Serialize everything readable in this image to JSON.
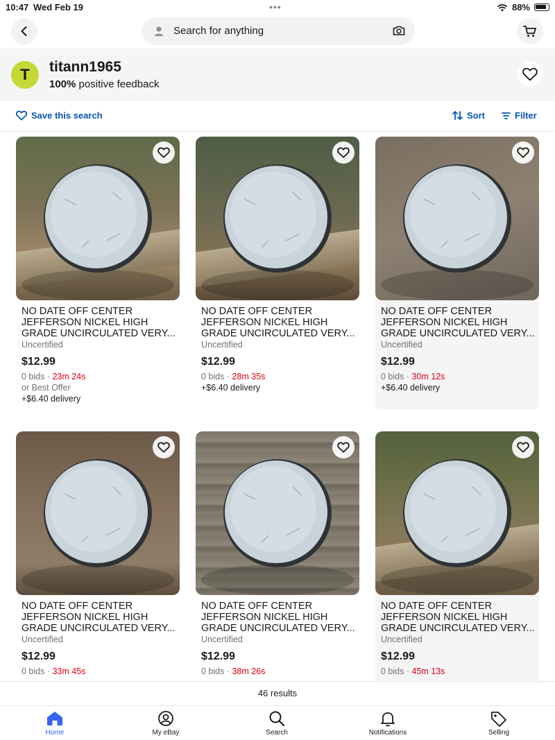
{
  "status_bar": {
    "time": "10:47",
    "date": "Wed Feb 19",
    "battery": "88%"
  },
  "search": {
    "placeholder": "Search for anything"
  },
  "seller": {
    "avatar_letter": "T",
    "name": "titann1965",
    "feedback_pct": "100%",
    "feedback_text": "positive feedback"
  },
  "toolbar": {
    "save_search": "Save this search",
    "sort": "Sort",
    "filter": "Filter"
  },
  "colors": {
    "link_blue": "#0654ba",
    "timer_red": "#e0000f",
    "avatar_lime": "#c5d836",
    "tab_active": "#3665f3"
  },
  "listings": [
    {
      "title": "NO DATE OFF CENTER JEFFERSON NICKEL HIGH GRADE UNCIRCULATED VERY...",
      "condition": "Uncertified",
      "price": "$12.99",
      "bids": "0 bids · ",
      "time_left": "23m 24s",
      "best_offer": "or Best Offer",
      "shipping": "+$6.40 delivery"
    },
    {
      "title": "NO DATE OFF CENTER JEFFERSON NICKEL HIGH GRADE UNCIRCULATED VERY...",
      "condition": "Uncertified",
      "price": "$12.99",
      "bids": "0 bids · ",
      "time_left": "28m 35s",
      "shipping": "+$6.40 delivery"
    },
    {
      "title": "NO DATE OFF CENTER JEFFERSON NICKEL HIGH GRADE UNCIRCULATED VERY...",
      "condition": "Uncertified",
      "price": "$12.99",
      "bids": "0 bids · ",
      "time_left": "30m 12s",
      "shipping": "+$6.40 delivery"
    },
    {
      "title": "NO DATE OFF CENTER JEFFERSON NICKEL HIGH GRADE UNCIRCULATED VERY...",
      "condition": "Uncertified",
      "price": "$12.99",
      "bids": "0 bids · ",
      "time_left": "33m 45s"
    },
    {
      "title": "NO DATE OFF CENTER JEFFERSON NICKEL HIGH GRADE UNCIRCULATED VERY...",
      "condition": "Uncertified",
      "price": "$12.99",
      "bids": "0 bids · ",
      "time_left": "38m 26s"
    },
    {
      "title": "NO DATE OFF CENTER JEFFERSON NICKEL HIGH GRADE UNCIRCULATED VERY...",
      "condition": "Uncertified",
      "price": "$12.99",
      "bids": "0 bids · ",
      "time_left": "45m 13s"
    }
  ],
  "results": "46 results",
  "tabs": [
    {
      "label": "Home",
      "icon": "home-icon",
      "active": true
    },
    {
      "label": "My eBay",
      "icon": "account-icon"
    },
    {
      "label": "Search",
      "icon": "search-icon"
    },
    {
      "label": "Notifications",
      "icon": "bell-icon"
    },
    {
      "label": "Selling",
      "icon": "tag-icon"
    }
  ]
}
